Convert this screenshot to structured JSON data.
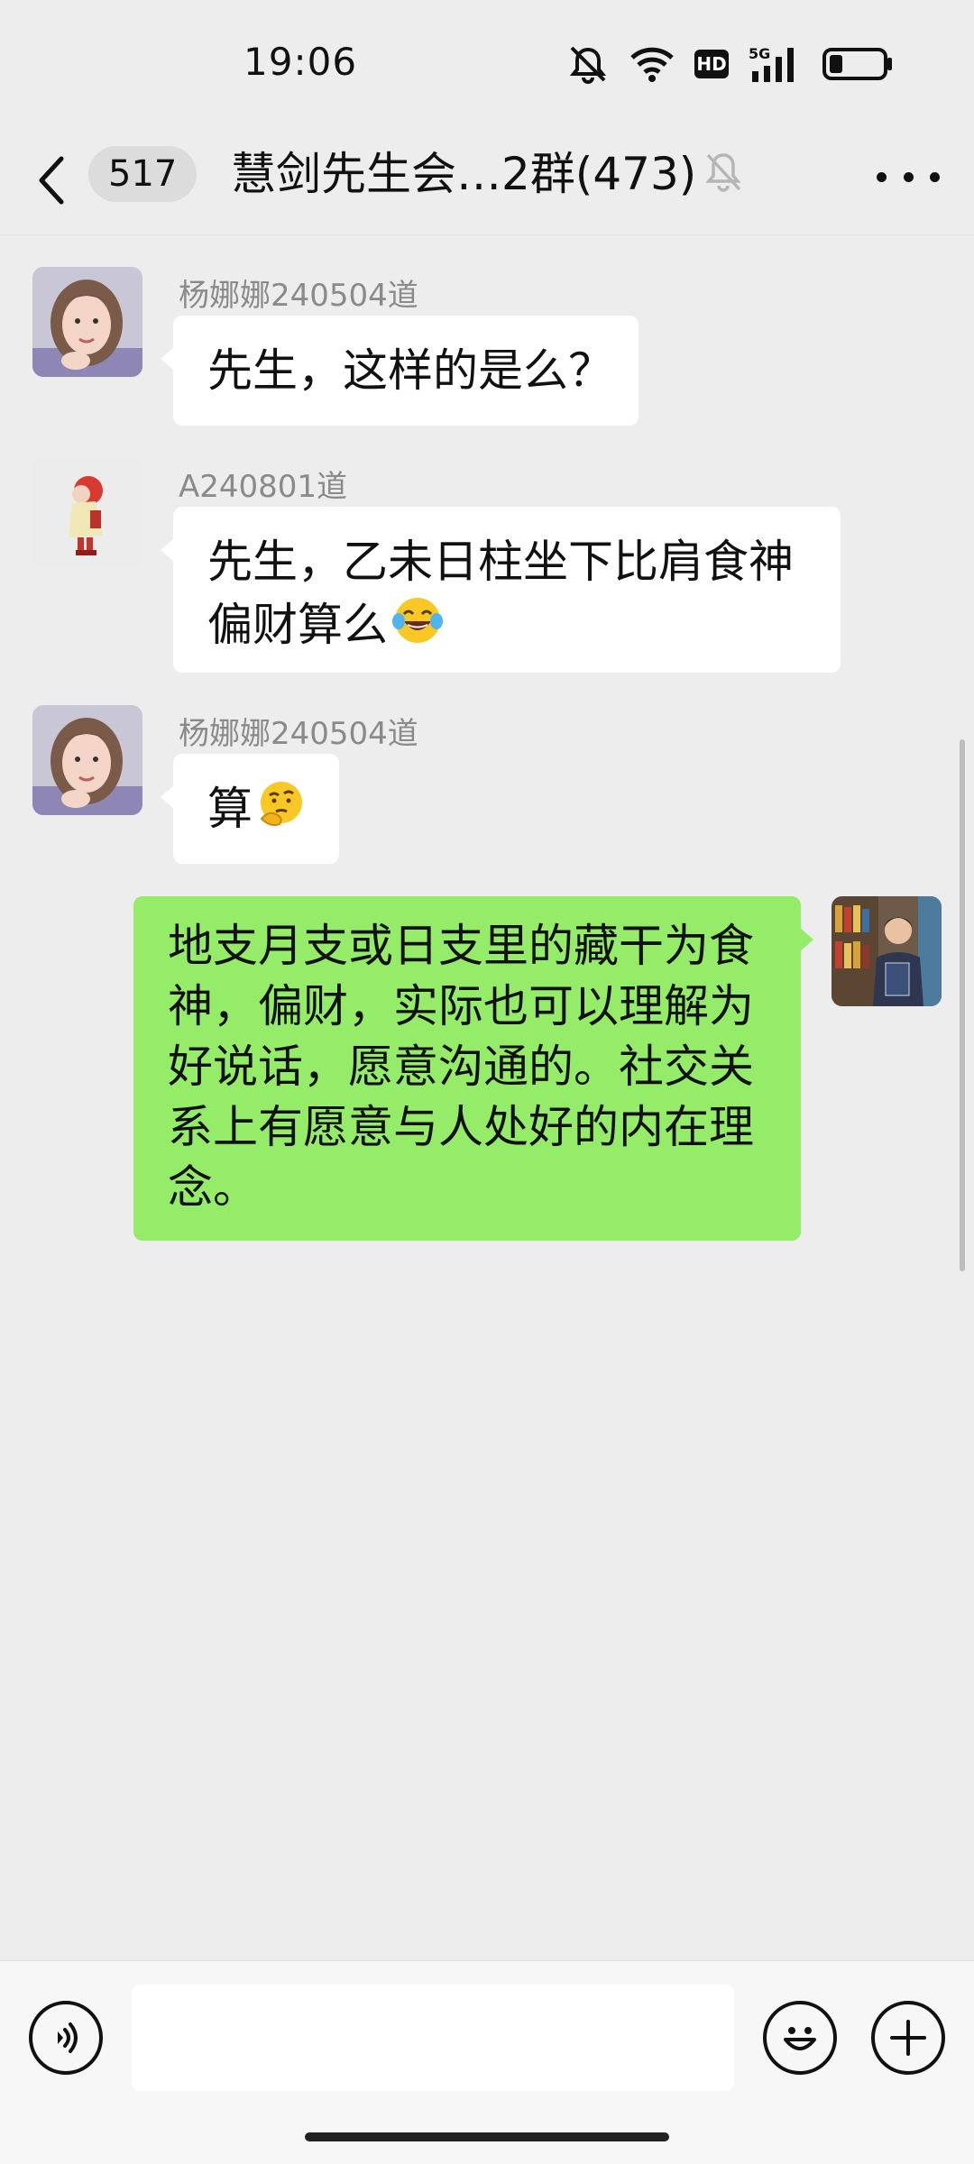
{
  "status_bar": {
    "time": "19:06",
    "network_label": "5G",
    "hd_label": "HD",
    "icons": [
      "mute-bell-icon",
      "wifi-icon",
      "hd-icon",
      "signal-5g-icon",
      "battery-icon"
    ],
    "battery_level": 0.25
  },
  "header": {
    "back_icon": "chevron-left-icon",
    "unread_count": "517",
    "title": "慧剑先生会…2群(473)",
    "muted_icon": "bell-muted-icon",
    "more_icon": "more-dots-icon"
  },
  "messages": [
    {
      "direction": "in",
      "sender": "杨娜娜240504道",
      "text": "先生，这样的是么？",
      "avatar": "woman-portrait-avatar"
    },
    {
      "direction": "in",
      "sender": "A240801道",
      "line1": "先生，乙未日柱坐下比肩食神",
      "line2": "偏财算么",
      "emoji": "tears-of-joy-emoji",
      "avatar": "cartoon-figure-avatar"
    },
    {
      "direction": "in",
      "sender": "杨娜娜240504道",
      "text": "算",
      "emoji": "thinking-emoji",
      "avatar": "woman-portrait-avatar"
    },
    {
      "direction": "out",
      "lines": [
        "地支月支或日支里的藏干为食",
        "神，偏财，实际也可以理解为",
        "好说话，愿意沟通的。社交关",
        "系上有愿意与人处好的内在理",
        "念。"
      ],
      "avatar": "man-with-book-avatar"
    }
  ],
  "input_bar": {
    "voice_icon": "voice-input-icon",
    "input_value": "",
    "emoji_icon": "smiley-icon",
    "plus_icon": "plus-icon"
  },
  "colors": {
    "background": "#ededed",
    "incoming_bubble": "#ffffff",
    "outgoing_bubble": "#95ec69"
  }
}
